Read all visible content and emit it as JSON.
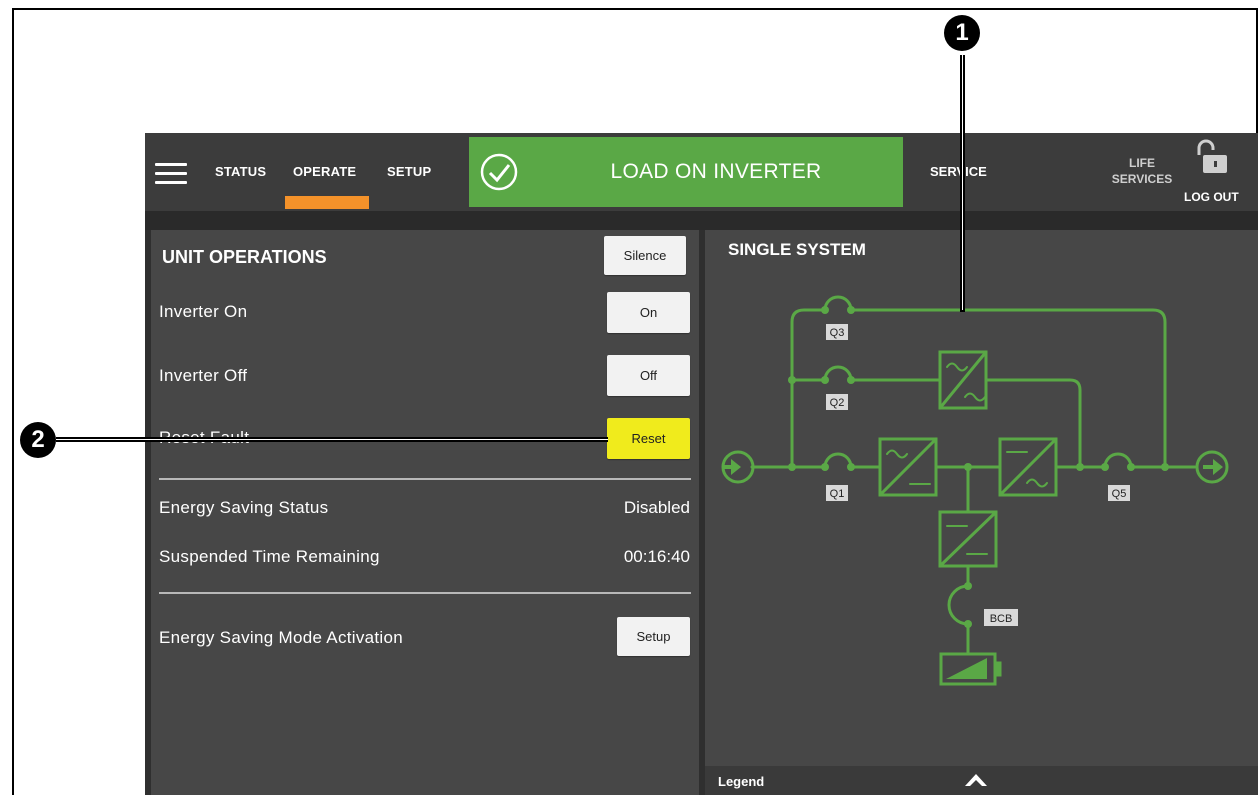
{
  "nav": {
    "status": "STATUS",
    "operate": "OPERATE",
    "setup": "SETUP",
    "service": "SERVICE",
    "life_line1": "LIFE",
    "life_line2": "SERVICES",
    "logout": "LOG OUT"
  },
  "banner": {
    "text": "LOAD ON INVERTER",
    "color": "#5aa846"
  },
  "unit_operations": {
    "title": "UNIT OPERATIONS",
    "silence_button": "Silence",
    "inverter_on_label": "Inverter On",
    "inverter_on_button": "On",
    "inverter_off_label": "Inverter Off",
    "inverter_off_button": "Off",
    "reset_fault_label": "Reset Fault",
    "reset_button": "Reset",
    "energy_saving_status_label": "Energy Saving Status",
    "energy_saving_status_value": "Disabled",
    "suspended_time_label": "Suspended Time Remaining",
    "suspended_time_value": "00:16:40",
    "activation_label": "Energy Saving Mode Activation",
    "activation_button": "Setup"
  },
  "single_system": {
    "title": "SINGLE SYSTEM",
    "breakers": {
      "q3": "Q3",
      "q2": "Q2",
      "q1": "Q1",
      "q5": "Q5",
      "bcb": "BCB"
    },
    "line_color": "#5aa846"
  },
  "legend": {
    "label": "Legend"
  },
  "callouts": {
    "one": "1",
    "two": "2"
  },
  "colors": {
    "accent": "#f4922a",
    "reset": "#f0eb1c"
  }
}
